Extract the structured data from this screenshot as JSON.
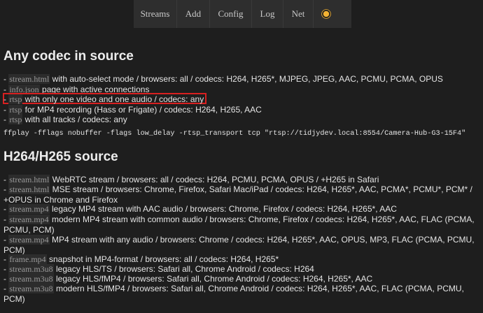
{
  "nav": {
    "items": [
      {
        "label": "Streams"
      },
      {
        "label": "Add"
      },
      {
        "label": "Config"
      },
      {
        "label": "Log"
      },
      {
        "label": "Net"
      }
    ],
    "theme_icon": "sun-icon"
  },
  "sections": [
    {
      "title": "Any codec in source",
      "rows": [
        {
          "prefix": "- ",
          "code": "stream.html",
          "text": " with auto-select mode / browsers: all / codecs: H264, H265*, MJPEG, JPEG, AAC, PCMU, PCMA, OPUS"
        },
        {
          "prefix": "- ",
          "code": "info.json",
          "text": " page with active connections"
        },
        {
          "prefix": "- ",
          "code": "rtsp",
          "text": " with only one video and one audio / codecs: any"
        },
        {
          "prefix": "- ",
          "code": "rtsp",
          "text": " for MP4 recording (Hass or Frigate) / codecs: H264, H265, AAC"
        },
        {
          "prefix": "- ",
          "code": "rtsp",
          "text": " with all tracks / codecs: any"
        }
      ],
      "command": "ffplay -fflags nobuffer -flags low_delay -rtsp_transport tcp \"rtsp://tidjydev.local:8554/Camera-Hub-G3-15F4\""
    },
    {
      "title": "H264/H265 source",
      "rows": [
        {
          "prefix": "- ",
          "code": "stream.html",
          "text": " WebRTC stream / browsers: all / codecs: H264, PCMU, PCMA, OPUS / +H265 in Safari"
        },
        {
          "prefix": "- ",
          "code": "stream.html",
          "text": " MSE stream / browsers: Chrome, Firefox, Safari Mac/iPad / codecs: H264, H265*, AAC, PCMA*, PCMU*, PCM* / +OPUS in Chrome and Firefox"
        },
        {
          "prefix": "- ",
          "code": "stream.mp4",
          "text": " legacy MP4 stream with AAC audio / browsers: Chrome, Firefox / codecs: H264, H265*, AAC"
        },
        {
          "prefix": "- ",
          "code": "stream.mp4",
          "text": " modern MP4 stream with common audio / browsers: Chrome, Firefox / codecs: H264, H265*, AAC, FLAC (PCMA, PCMU, PCM)"
        },
        {
          "prefix": "- ",
          "code": "stream.mp4",
          "text": " MP4 stream with any audio / browsers: Chrome / codecs: H264, H265*, AAC, OPUS, MP3, FLAC (PCMA, PCMU, PCM)"
        },
        {
          "prefix": "- ",
          "code": "frame.mp4",
          "text": " snapshot in MP4-format / browsers: all / codecs: H264, H265*"
        },
        {
          "prefix": "- ",
          "code": "stream.m3u8",
          "text": " legacy HLS/TS / browsers: Safari all, Chrome Android / codecs: H264"
        },
        {
          "prefix": "- ",
          "code": "stream.m3u8",
          "text": " legacy HLS/fMP4 / browsers: Safari all, Chrome Android / codecs: H264, H265*, AAC"
        },
        {
          "prefix": "- ",
          "code": "stream.m3u8",
          "text": " modern HLS/fMP4 / browsers: Safari all, Chrome Android / codecs: H264, H265*, AAC, FLAC (PCMA, PCMU, PCM)"
        }
      ]
    }
  ],
  "colors": {
    "background": "#1e1e1e",
    "nav_background": "#2e2e2e",
    "highlight_border": "#d82020",
    "sun": "#f2b233"
  }
}
